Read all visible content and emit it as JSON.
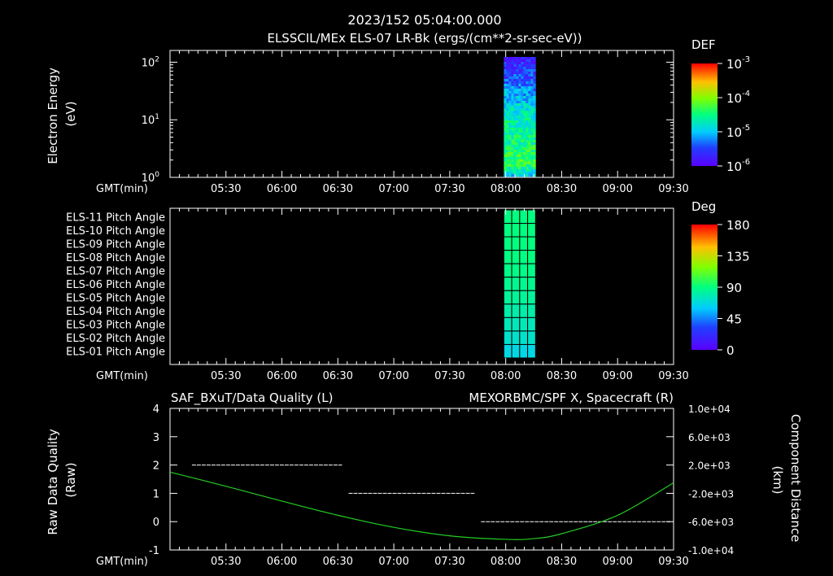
{
  "header": {
    "title": "2023/152 05:04:00.000",
    "subtitle": "ELSSCIL/MEx ELS-07 LR-Bk  (ergs/(cm**2-sr-sec-eV))"
  },
  "time_axis": {
    "label": "GMT(min)",
    "ticks": [
      "05:30",
      "06:00",
      "06:30",
      "07:00",
      "07:30",
      "08:00",
      "08:30",
      "09:00",
      "09:30"
    ],
    "range_minutes": [
      300,
      570
    ]
  },
  "colors": {
    "background": "#000000",
    "axes": "#ffffff",
    "quality_trace": "#ffffff",
    "spacecraft_trace": "#22cc22",
    "right_title": "#22cc22"
  },
  "chart_data": [
    {
      "type": "heatmap",
      "ylabel_line1": "Electron Energy",
      "ylabel_line2": "(eV)",
      "y_ticks": [
        {
          "base": "10",
          "exp": "0",
          "value": 1
        },
        {
          "base": "10",
          "exp": "1",
          "value": 10
        },
        {
          "base": "10",
          "exp": "2",
          "value": 100
        }
      ],
      "ylim": [
        1,
        160
      ],
      "y_scale": "log",
      "data_time_range": [
        "07:59",
        "08:16"
      ],
      "colorbar": {
        "title": "DEF",
        "scale": "log",
        "range": [
          1e-06,
          0.001
        ],
        "ticks": [
          {
            "base": "10",
            "exp": "-3"
          },
          {
            "base": "10",
            "exp": "-4"
          },
          {
            "base": "10",
            "exp": "-5"
          },
          {
            "base": "10",
            "exp": "-6"
          }
        ]
      }
    },
    {
      "type": "heatmap",
      "row_labels": [
        "ELS-11 Pitch Angle",
        "ELS-10 Pitch Angle",
        "ELS-09 Pitch Angle",
        "ELS-08 Pitch Angle",
        "ELS-07 Pitch Angle",
        "ELS-06 Pitch Angle",
        "ELS-05 Pitch Angle",
        "ELS-04 Pitch Angle",
        "ELS-03 Pitch Angle",
        "ELS-02 Pitch Angle",
        "ELS-01 Pitch Angle"
      ],
      "row_values_deg": [
        90,
        90,
        90,
        90,
        88,
        86,
        84,
        80,
        76,
        72,
        66
      ],
      "data_time_range": [
        "07:59",
        "08:16"
      ],
      "colorbar": {
        "title": "Deg",
        "range": [
          0,
          180
        ],
        "ticks": [
          "180",
          "135",
          "90",
          "45",
          "0"
        ]
      }
    },
    {
      "type": "line",
      "title_left": "SAF_BXuT/Data Quality (L)",
      "title_right": "MEXORBMC/SPF X, Spacecraft (R)",
      "ylabel_left_line1": "Raw Data Quality",
      "ylabel_left_line2": "(Raw)",
      "ylabel_right_line1": "Component Distance",
      "ylabel_right_line2": "(km)",
      "ylim_left": [
        -1,
        4
      ],
      "left_ticks": [
        "4",
        "3",
        "2",
        "1",
        "0",
        "-1"
      ],
      "ylim_right": [
        -10000,
        10000
      ],
      "right_ticks": [
        "1.0e+04",
        "6.0e+03",
        "2.0e+03",
        "-2.0e+03",
        "-6.0e+03",
        "-1.0e+04"
      ],
      "series": [
        {
          "name": "SAF_BXuT/Data Quality (L)",
          "axis": "left",
          "style": "dashed",
          "segments": [
            {
              "x": [
                "05:10",
                "06:34"
              ],
              "y": 2
            },
            {
              "x": [
                "06:34",
                "07:45"
              ],
              "y": 1
            },
            {
              "x": [
                "07:45",
                "09:30"
              ],
              "y": 0
            }
          ]
        },
        {
          "name": "MEXORBMC/SPF X, Spacecraft (R)",
          "axis": "right",
          "style": "solid",
          "x": [
            "05:00",
            "05:30",
            "06:00",
            "06:30",
            "07:00",
            "07:30",
            "08:00",
            "08:15",
            "08:30",
            "09:00",
            "09:30"
          ],
          "y": [
            1000,
            -1000,
            -3100,
            -5100,
            -6800,
            -8000,
            -8500,
            -8400,
            -7700,
            -5100,
            -500
          ]
        }
      ]
    }
  ]
}
